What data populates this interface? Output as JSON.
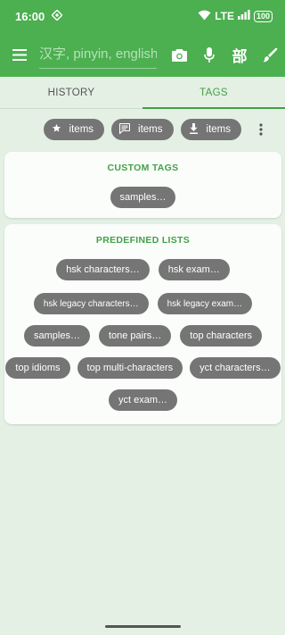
{
  "status_bar": {
    "time": "16:00",
    "network": "LTE",
    "battery": "100"
  },
  "app_bar": {
    "search_placeholder": "汉字, pinyin, english",
    "radical_label": "部",
    "icons": [
      "menu-icon",
      "camera-icon",
      "microphone-icon",
      "radical-icon",
      "brush-icon"
    ]
  },
  "tabs": [
    {
      "label": "HISTORY",
      "active": false
    },
    {
      "label": "TAGS",
      "active": true
    }
  ],
  "toolbar_chips": [
    {
      "label": "items",
      "icon": "star-icon"
    },
    {
      "label": "items",
      "icon": "comment-icon"
    },
    {
      "label": "items",
      "icon": "download-icon"
    }
  ],
  "custom_tags": {
    "title": "CUSTOM TAGS",
    "items": [
      "samples…"
    ]
  },
  "predefined_lists": {
    "title": "PREDEFINED LISTS",
    "items": [
      "hsk characters…",
      "hsk exam…",
      "hsk legacy characters…",
      "hsk legacy exam…",
      "samples…",
      "tone pairs…",
      "top characters",
      "top idioms",
      "top multi-characters",
      "yct characters…",
      "yct exam…"
    ]
  },
  "colors": {
    "primary": "#4caf50",
    "accent_text": "#43a047",
    "chip": "#757575",
    "background": "#e4f0e4"
  }
}
